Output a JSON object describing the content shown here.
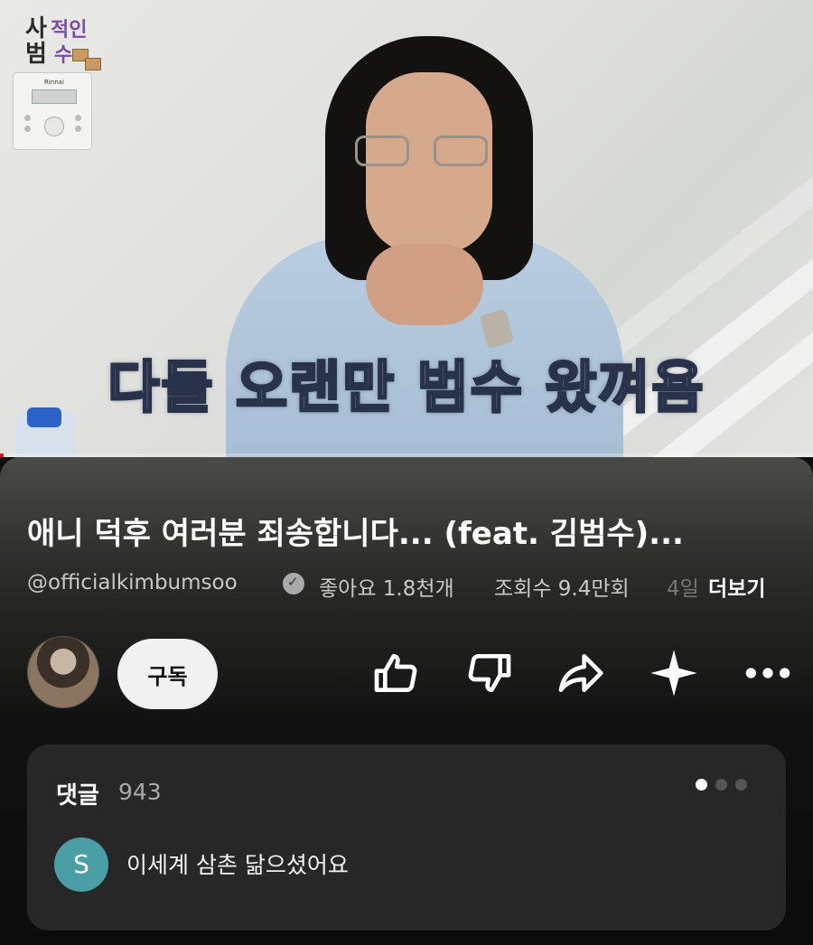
{
  "video": {
    "caption": "다들 오랜만 범수 왔껴욤",
    "channel_logo": [
      "사",
      "범",
      "적인",
      "수"
    ],
    "thermostat_brand": "Rinnai",
    "progress_fraction": 0.004,
    "accent_color": "#ff0000"
  },
  "info": {
    "title": "애니 덕후 여러분 죄송합니다... (feat. 김범수)...",
    "channel_handle": "@officialkimbumsoo",
    "likes": "좋아요 1.8천개",
    "views": "조회수 9.4만회",
    "date": "4일",
    "more_label": "더보기"
  },
  "actions": {
    "subscribe_label": "구독",
    "icons": [
      "thumbs-up-icon",
      "thumbs-down-icon",
      "share-icon",
      "sparkle-icon",
      "more-icon"
    ]
  },
  "comments": {
    "header": "댓글",
    "count": "943",
    "first_comment": {
      "avatar_letter": "S",
      "text": "이세계 삼촌 닮으셨어요"
    }
  }
}
